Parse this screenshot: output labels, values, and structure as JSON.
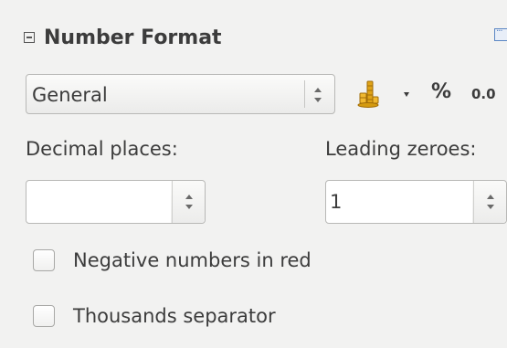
{
  "header": {
    "title": "Number Format",
    "collapse_icon": "collapse-minus-icon",
    "more_icon": "more-options-icon"
  },
  "format": {
    "selected": "General"
  },
  "toolbar": {
    "currency_icon": "currency-coins-icon",
    "currency_dropdown_icon": "dropdown-arrow-icon",
    "percent_label": "%",
    "decimal_label": "0.0"
  },
  "decimal_places": {
    "label": "Decimal places:",
    "value": ""
  },
  "leading_zeroes": {
    "label": "Leading zeroes:",
    "value": "1"
  },
  "options": {
    "negative_red": {
      "label": "Negative numbers in red",
      "checked": false
    },
    "thousands_separator": {
      "label": "Thousands separator",
      "checked": false
    }
  },
  "colors": {
    "background": "#f2f2f1",
    "text": "#3c3c3c",
    "border": "#b8b8b6",
    "accent_icon_blue": "#5b86c4",
    "coin_gold": "#e0a418"
  }
}
